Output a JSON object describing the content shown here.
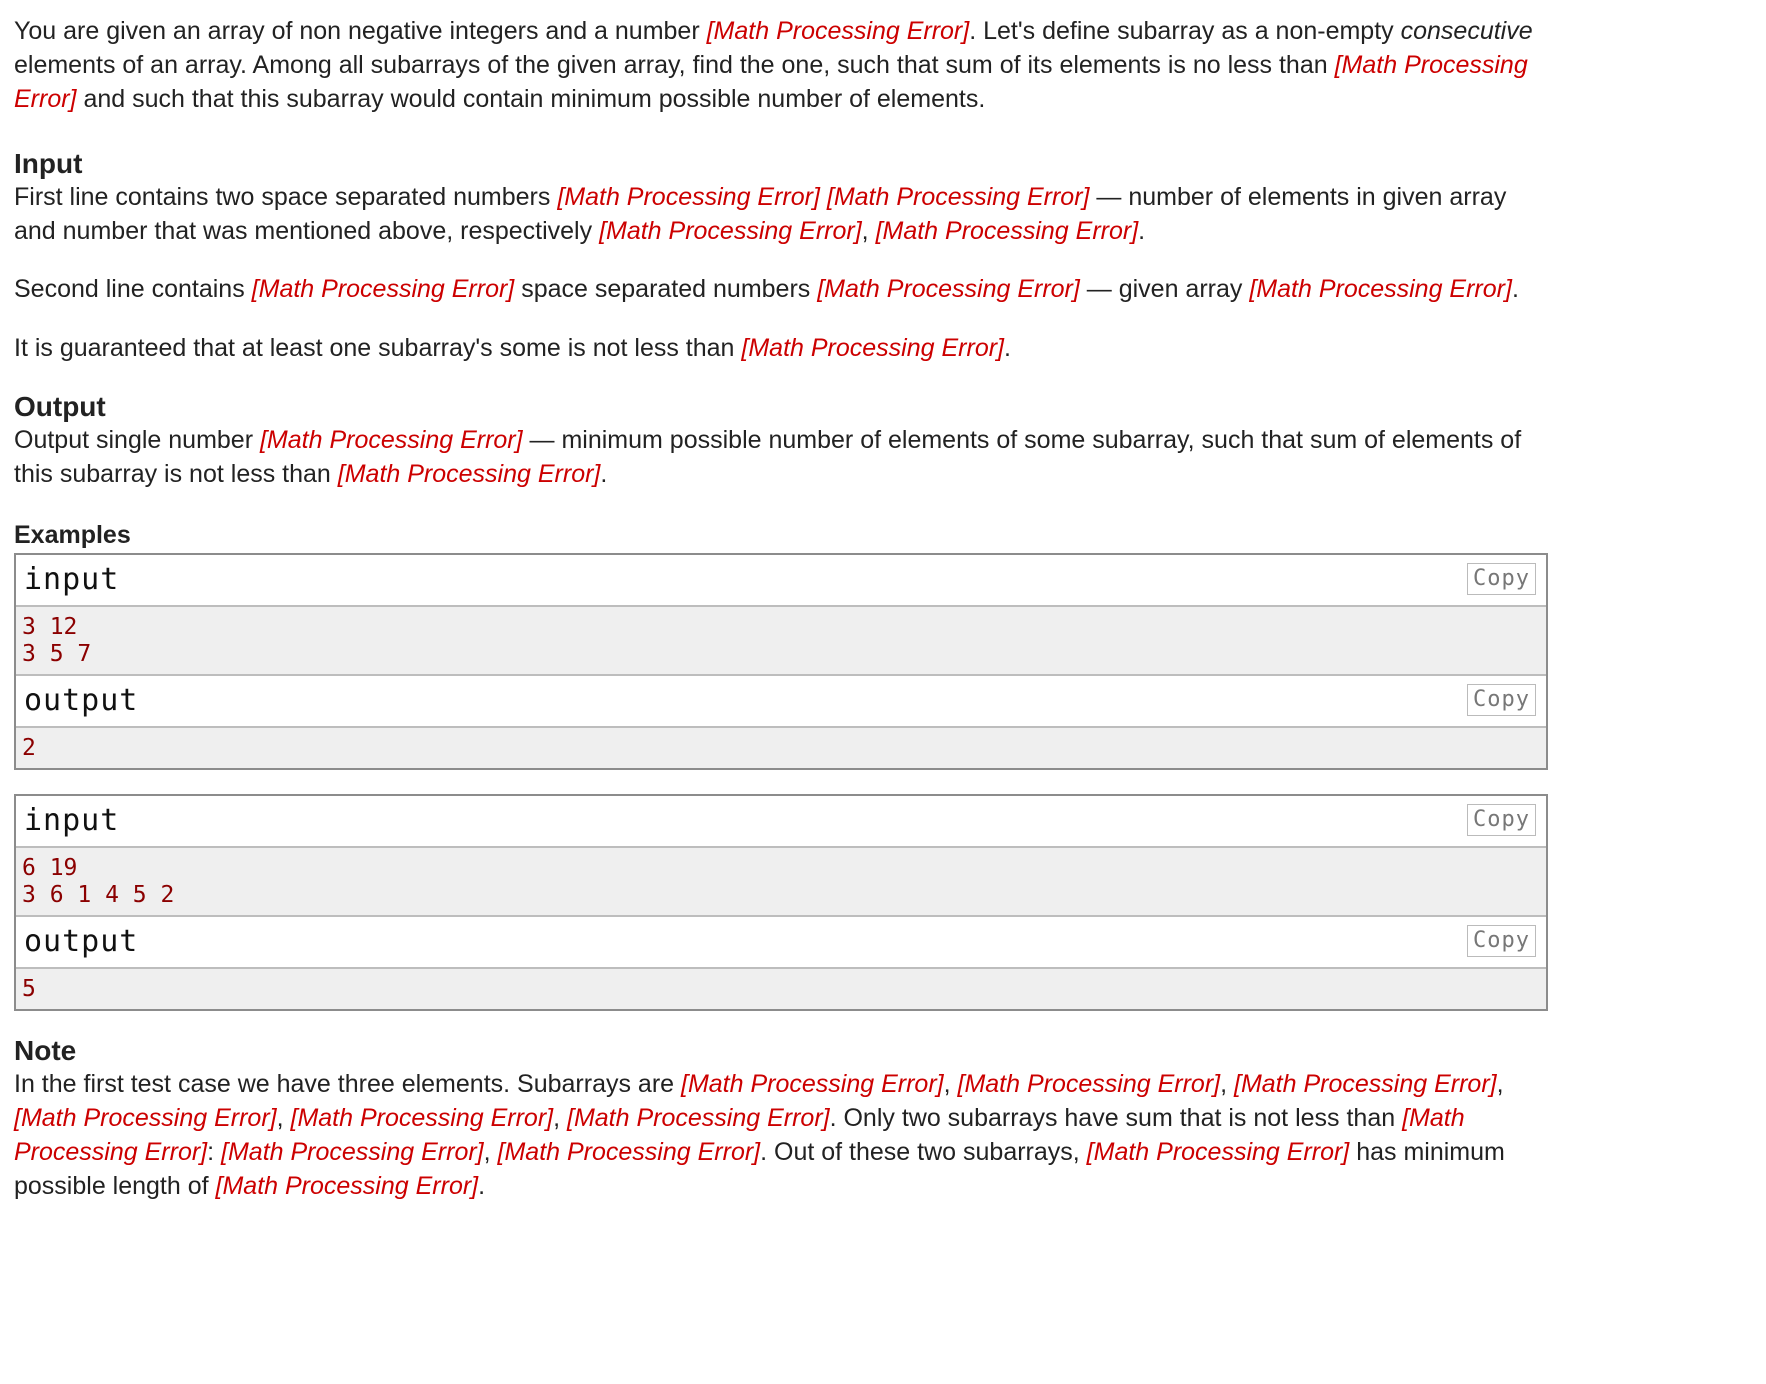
{
  "err": "[Math Processing Error]",
  "intro": {
    "t1": "You are given an array of non negative integers and a number ",
    "t2": ". Let's define subarray as a non-empty ",
    "t3": "consecutive",
    "t4": " elements of an array. Among all subarrays of the given array, find the one, such that sum of its elements is no less than ",
    "t5": " and such that this subarray would contain minimum possible number of elements."
  },
  "input_section": {
    "title": "Input",
    "p1": {
      "t1": "First line contains two space separated numbers ",
      "t2": " ",
      "t3": " — number of elements in given array and number that was mentioned above, respectively ",
      "t4": ", ",
      "t5": "."
    },
    "p2": {
      "t1": "Second line contains ",
      "t2": " space separated numbers ",
      "t3": " — given array ",
      "t4": "."
    },
    "p3": {
      "t1": "It is guaranteed that at least one subarray's some is not less than ",
      "t2": "."
    }
  },
  "output_section": {
    "title": "Output",
    "p1": {
      "t1": "Output single number ",
      "t2": " — minimum possible number of elements of some subarray, such that sum of elements of this subarray is not less than ",
      "t3": "."
    }
  },
  "examples": {
    "title": "Examples",
    "copy_label": "Copy",
    "input_label": "input",
    "output_label": "output",
    "items": [
      {
        "input": "3 12\n3 5 7",
        "output": "2"
      },
      {
        "input": "6 19\n3 6 1 4 5 2",
        "output": "5"
      }
    ]
  },
  "note": {
    "title": "Note",
    "t1": "In the first test case we have three elements. Subarrays are ",
    "sep": ", ",
    "t2": ". Only two subarrays have sum that is not less than ",
    "t3": ": ",
    "t4": ". Out of these two subarrays, ",
    "t5": " has minimum possible length of ",
    "t6": "."
  },
  "colors": {
    "error": "#cc0000",
    "sample_text": "#8b0000",
    "sample_bg": "#efefef"
  }
}
